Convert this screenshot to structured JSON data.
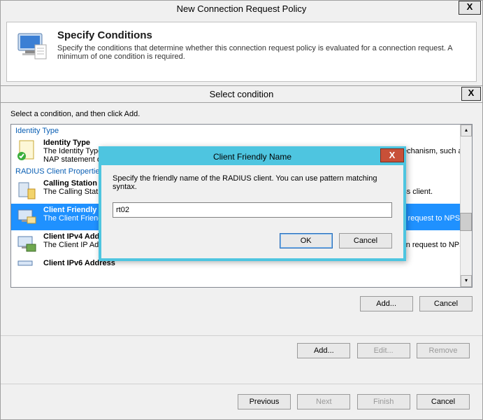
{
  "outer": {
    "title": "New Connection Request Policy",
    "close": "X"
  },
  "header": {
    "title": "Specify Conditions",
    "desc": "Specify the conditions that determine whether this connection request policy is evaluated for a connection request. A minimum of one condition is required."
  },
  "sc": {
    "title": "Select condition",
    "close": "X",
    "instr": "Select a condition, and then click Add.",
    "sectionA": "Identity Type",
    "sectionB": "RADIUS Client Properties",
    "items": {
      "idtype": {
        "t": "Identity Type",
        "d": "The Identity Type condition restricts the policy to only clients that can be identified through the specified mechanism, such as NAP statement of health (SoH)."
      },
      "calling": {
        "t": "Calling Station ID",
        "d": "The Calling Station ID condition specifies the network access server telephone number dialed by the access client."
      },
      "friendly": {
        "t": "Client Friendly Name",
        "d": "The Client Friendly Name condition specifies the name of the RADIUS client that forwarded the connection request to NPS."
      },
      "ipv4": {
        "t": "Client IPv4 Address",
        "d": "The Client IP Address condition specifies the IP address of the RADIUS client that forwarded the connection request to NPS."
      },
      "ipv6": {
        "t": "Client IPv6 Address",
        "d": ""
      }
    },
    "add": "Add...",
    "cancel": "Cancel"
  },
  "row1": {
    "add": "Add...",
    "edit": "Edit...",
    "remove": "Remove"
  },
  "row2": {
    "prev": "Previous",
    "next": "Next",
    "finish": "Finish",
    "cancel": "Cancel"
  },
  "modal": {
    "title": "Client Friendly Name",
    "close": "X",
    "desc": "Specify the friendly name of the RADIUS client. You can use pattern matching syntax.",
    "value": "rt02",
    "ok": "OK",
    "cancel": "Cancel"
  }
}
